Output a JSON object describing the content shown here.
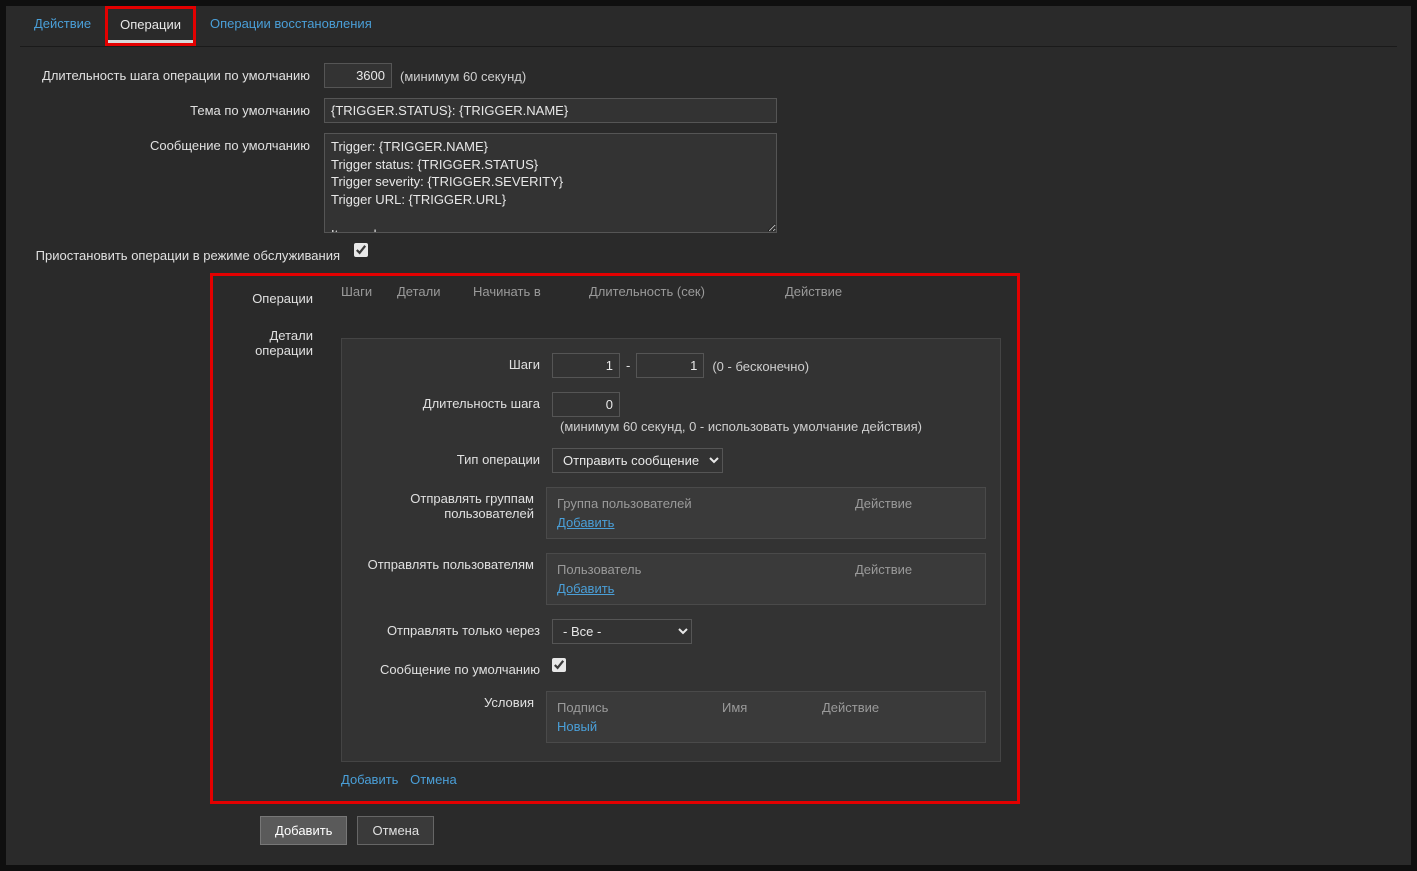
{
  "tabs": {
    "action": "Действие",
    "operations": "Операции",
    "recovery": "Операции восстановления"
  },
  "form": {
    "step_duration_label": "Длительность шага операции по умолчанию",
    "step_duration_value": "3600",
    "step_duration_hint": "(минимум 60 секунд)",
    "default_subject_label": "Тема по умолчанию",
    "default_subject_value": "{TRIGGER.STATUS}: {TRIGGER.NAME}",
    "default_message_label": "Сообщение по умолчанию",
    "default_message_value": "Trigger: {TRIGGER.NAME}\nTrigger status: {TRIGGER.STATUS}\nTrigger severity: {TRIGGER.SEVERITY}\nTrigger URL: {TRIGGER.URL}\n\nItem values:",
    "pause_label": "Приостановить операции в режиме обслуживания"
  },
  "ops": {
    "label": "Операции",
    "col_steps": "Шаги",
    "col_details": "Детали",
    "col_start": "Начинать в",
    "col_duration": "Длительность (сек)",
    "col_action": "Действие"
  },
  "detail": {
    "label": "Детали операции",
    "steps_label": "Шаги",
    "steps_from": "1",
    "steps_to": "1",
    "steps_hint": "(0 - бесконечно)",
    "step_duration_label": "Длительность шага",
    "step_duration_value": "0",
    "step_duration_hint": "(минимум 60 секунд, 0 - использовать умолчание действия)",
    "op_type_label": "Тип операции",
    "op_type_value": "Отправить сообщение",
    "send_groups_label": "Отправлять группам пользователей",
    "groups_col1": "Группа пользователей",
    "action_col": "Действие",
    "add_link": "Добавить",
    "send_users_label": "Отправлять пользователям",
    "users_col1": "Пользователь",
    "send_via_label": "Отправлять только через",
    "send_via_value": "- Все -",
    "default_msg_label": "Сообщение по умолчанию",
    "conditions_label": "Условия",
    "cond_col1": "Подпись",
    "cond_col2": "Имя",
    "new_link": "Новый"
  },
  "links": {
    "add": "Добавить",
    "cancel": "Отмена"
  },
  "buttons": {
    "add": "Добавить",
    "cancel": "Отмена"
  }
}
